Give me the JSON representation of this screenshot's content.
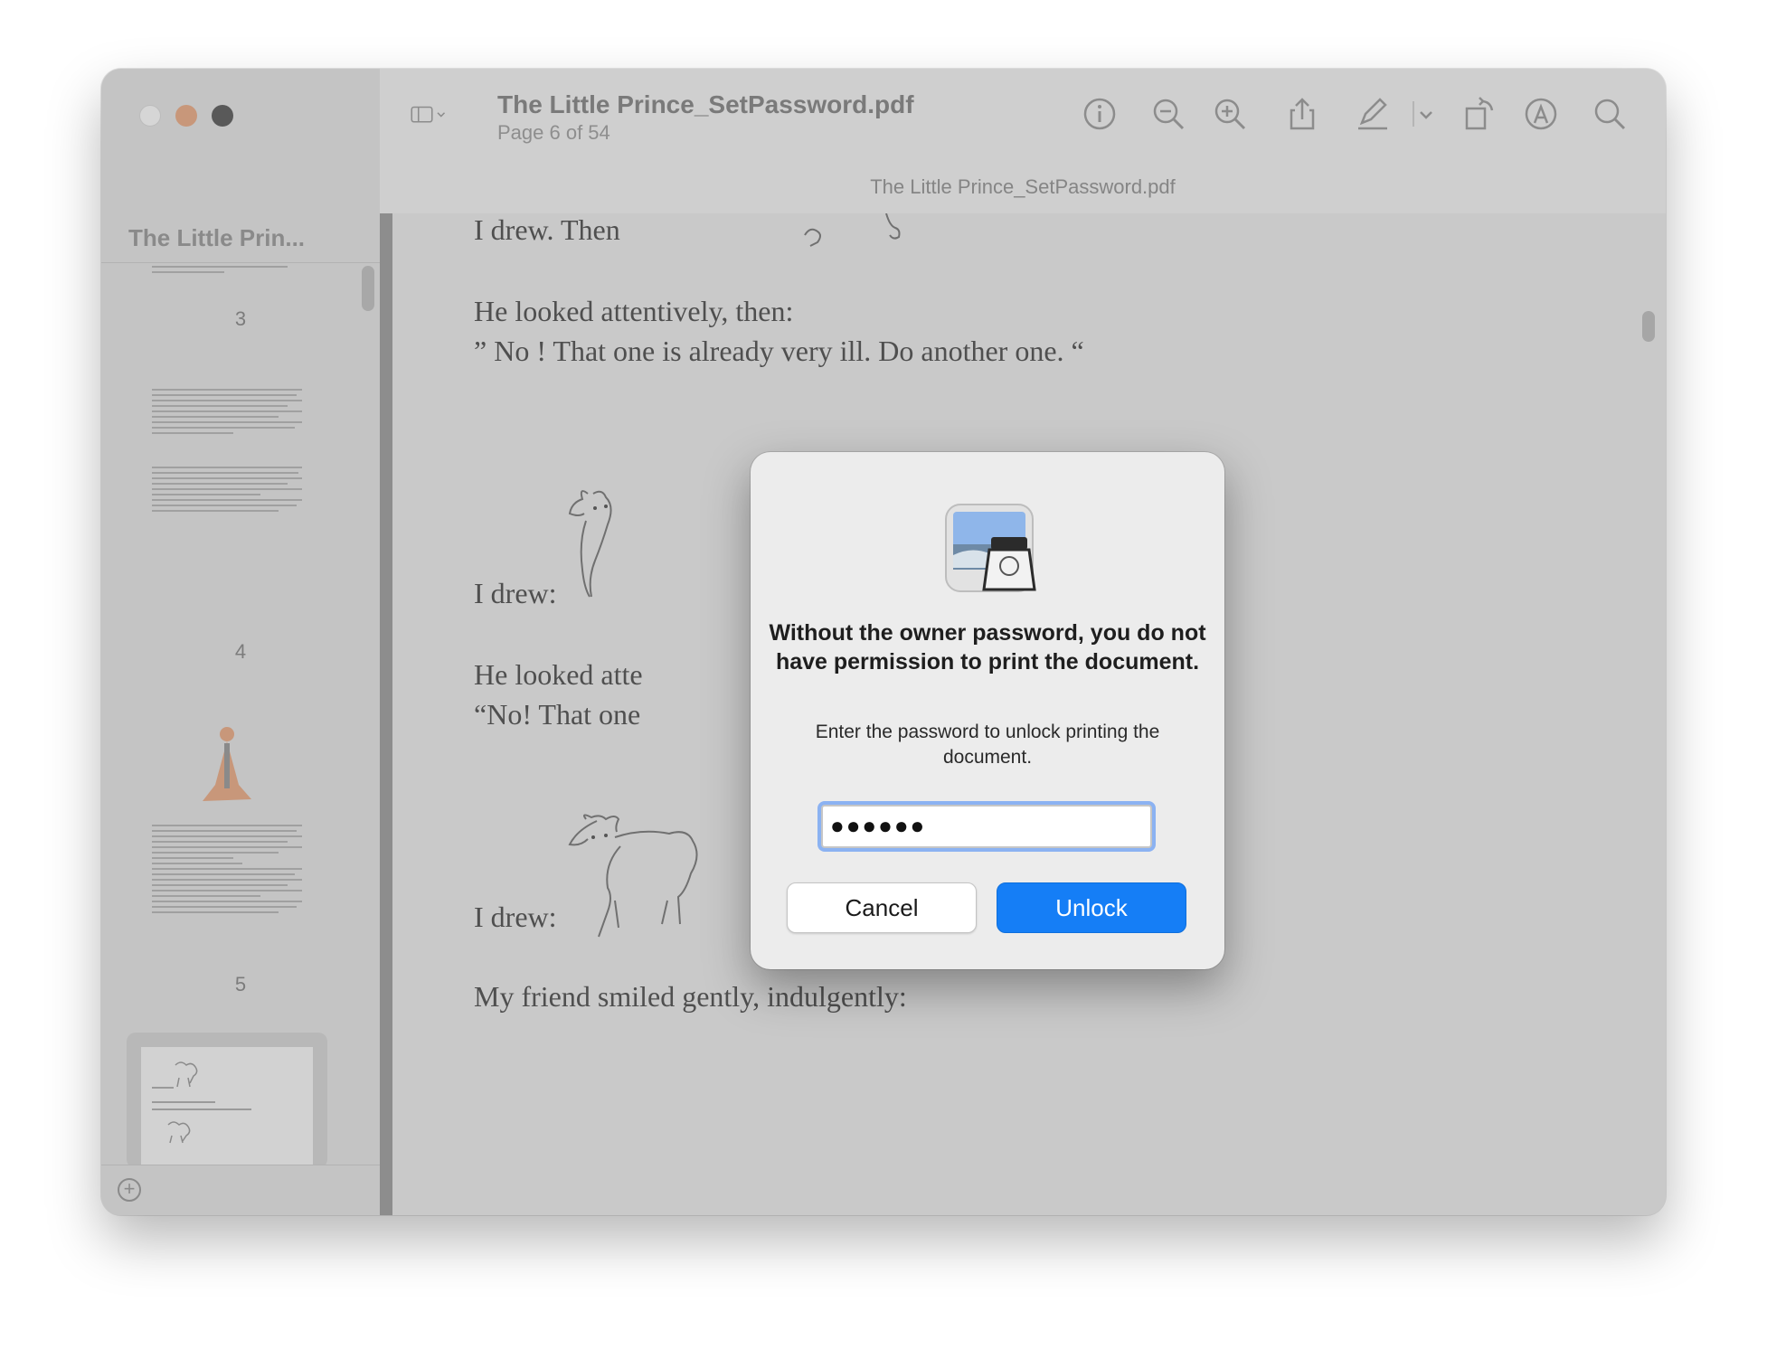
{
  "window": {
    "doc_title": "The Little Prince_SetPassword.pdf",
    "page_indicator": "Page 6 of 54",
    "tab_title": "The Little Prince_SetPassword.pdf"
  },
  "toolbar_icons": [
    "sidebar-toggle-icon",
    "info-icon",
    "zoom-out-icon",
    "zoom-in-icon",
    "share-icon",
    "markup-pen-icon",
    "rotate-icon",
    "annotate-icon",
    "search-icon"
  ],
  "sidebar": {
    "title": "The Little Prin...",
    "page_numbers": [
      "3",
      "4",
      "5"
    ]
  },
  "pdf": {
    "lines": [
      "I drew.  Then",
      "He looked attentively, then:",
      "” No ! That one is already very ill. Do another one. “",
      "I drew:",
      "He looked atte",
      "“No! That one",
      "I drew:",
      "My friend smiled gently, indulgently:"
    ]
  },
  "dialog": {
    "title": "Without the owner password, you do not have permission to print the document.",
    "message": "Enter the password to unlock printing the document.",
    "password_value": "●●●●●●",
    "cancel_label": "Cancel",
    "unlock_label": "Unlock"
  },
  "colors": {
    "accent": "#157ef6",
    "focus_ring": "#8bb2f2",
    "traffic_min": "#c8977a",
    "traffic_max": "#595959"
  }
}
